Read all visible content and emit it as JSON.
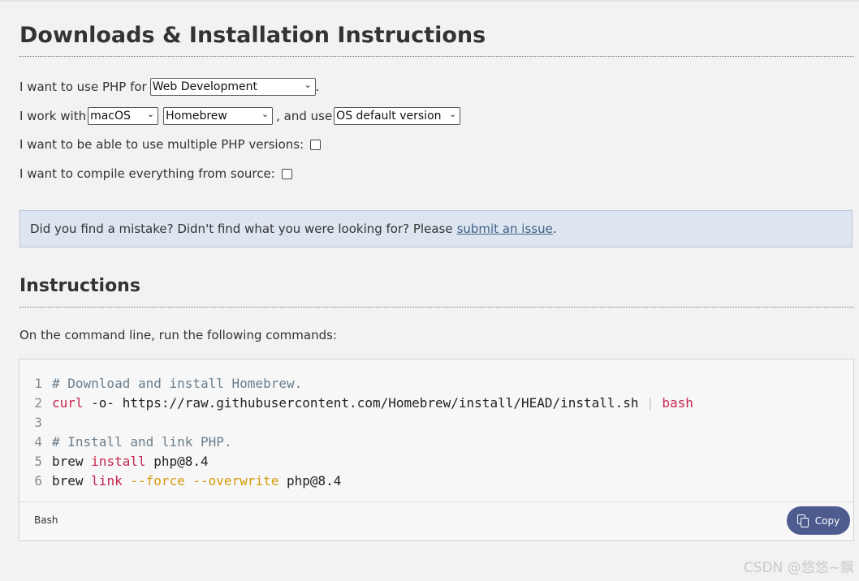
{
  "page": {
    "title": "Downloads & Installation Instructions"
  },
  "form": {
    "use_php_for_label": "I want to use PHP for",
    "use_php_for_value": "Web Development",
    "use_php_for_suffix": ".",
    "work_with_label": "I work with",
    "os_value": "macOS",
    "method_value": "Homebrew",
    "and_use_label": ", and use",
    "version_value": "OS default version",
    "multiple_versions_label": "I want to be able to use multiple PHP versions:",
    "compile_source_label": "I want to compile everything from source:"
  },
  "notice": {
    "text": "Did you find a mistake? Didn't find what you were looking for? Please",
    "link_text": "submit an issue",
    "suffix": "."
  },
  "instructions": {
    "heading": "Instructions",
    "intro": "On the command line, run the following commands:",
    "language": "Bash",
    "copy_label": "Copy",
    "lines": [
      {
        "num": "1",
        "comment": "# Download and install Homebrew."
      },
      {
        "num": "2",
        "cmd": "curl",
        "args": " -o- https://raw.githubusercontent.com/Homebrew/install/HEAD/install.sh ",
        "pipe": "|",
        "cmd2": " bash"
      },
      {
        "num": "3"
      },
      {
        "num": "4",
        "comment": "# Install and link PHP."
      },
      {
        "num": "5",
        "prefix": "brew ",
        "cmd": "install",
        "args": " php@8.4"
      },
      {
        "num": "6",
        "prefix": "brew ",
        "cmd": "link",
        "flag1": " --force",
        "flag2": " --overwrite",
        "args": " php@8.4"
      }
    ]
  },
  "watermark": "CSDN @悠悠~飘",
  "colors": {
    "notice_bg": "#dde6f0",
    "link": "#3f5f86",
    "code_command": "#c8244e",
    "code_flag": "#d79a0a",
    "code_comment": "#6a7e8c",
    "copy_button": "#4d5b8f"
  }
}
